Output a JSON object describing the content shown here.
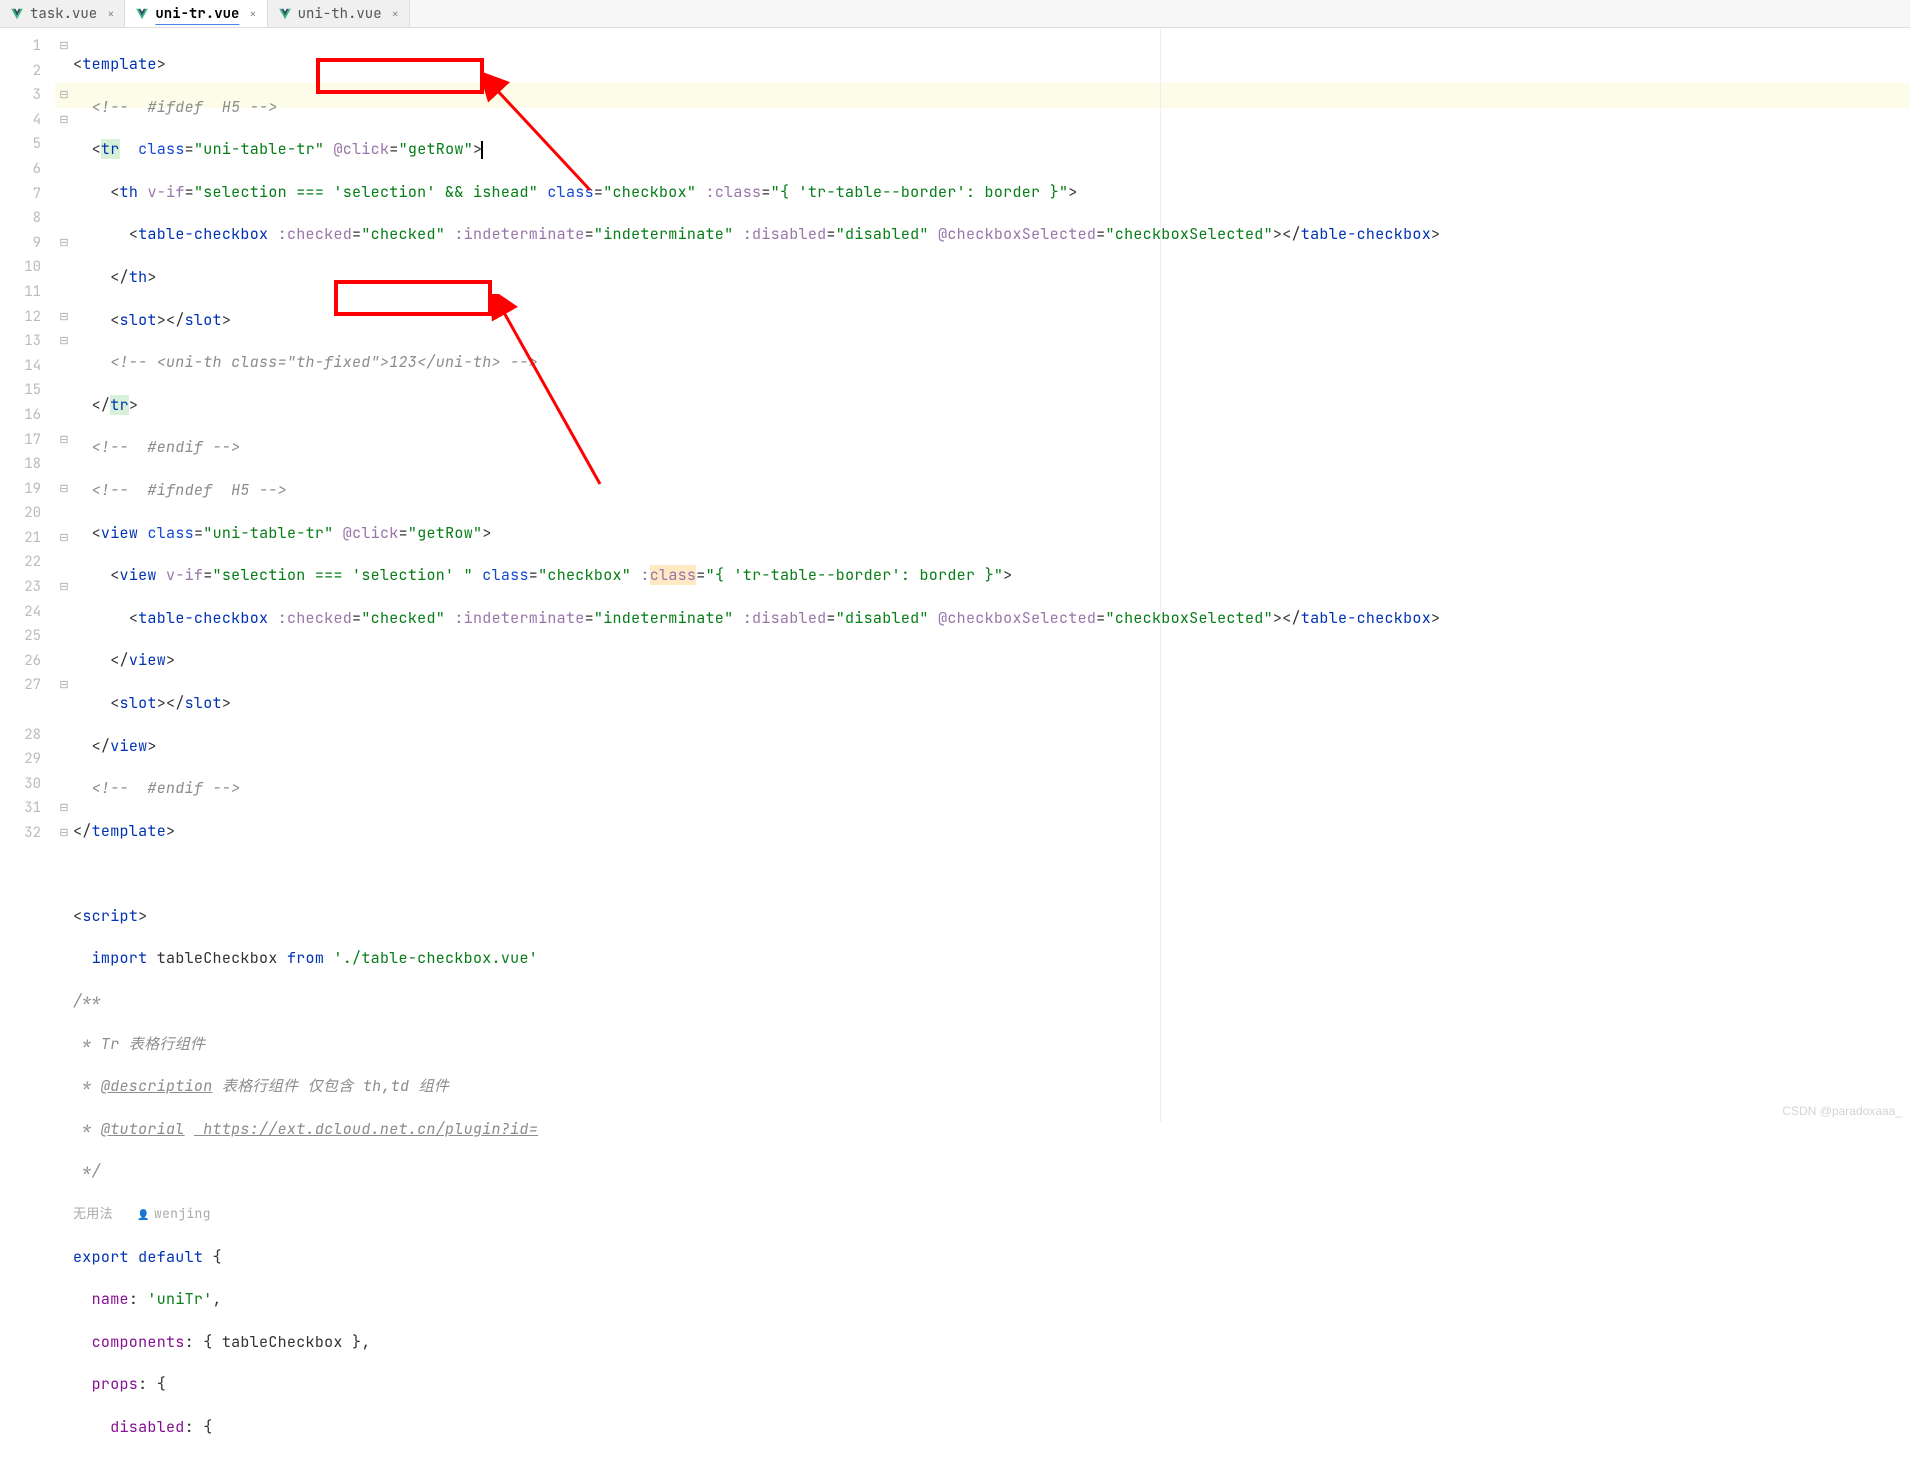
{
  "tabs": [
    {
      "name": "task.vue",
      "active": false
    },
    {
      "name": "uni-tr.vue",
      "active": true
    },
    {
      "name": "uni-th.vue",
      "active": false
    }
  ],
  "hint": {
    "usage": "无用法",
    "author": "wenjing"
  },
  "watermark": "CSDN @paradoxaaa_",
  "code": {
    "l1": {
      "lt": "<",
      "tag": "template",
      "gt": ">"
    },
    "l2": {
      "comment": "<!--  #ifdef  H5 -->"
    },
    "l3": {
      "lt": "<",
      "tag": "tr",
      "sp": "  ",
      "a1": "class",
      "eq": "=",
      "v1": "\"uni-table-tr\"",
      "sp2": " ",
      "a2": "@click",
      "v2": "\"getRow\"",
      "gt": ">"
    },
    "l4": {
      "lt": "<",
      "tag": "th",
      "sp": " ",
      "a1": "v-if",
      "v1": "\"selection === 'selection' && ishead\"",
      "a2": "class",
      "v2": "\"checkbox\"",
      "a3": ":class",
      "v3": "\"{ 'tr-table--border': border }\"",
      "gt": ">"
    },
    "l5": {
      "lt": "<",
      "tag": "table-checkbox",
      "a1": ":checked",
      "v1": "\"checked\"",
      "a2": ":indeterminate",
      "v2": "\"indeterminate\"",
      "a3": ":disabled",
      "v3": "\"disabled\"",
      "a4": "@checkboxSelected",
      "v4": "\"checkboxSelected\"",
      "gt": "></",
      "tag2": "table-checkbox",
      "gt2": ">"
    },
    "l6": {
      "cl": "</",
      "tag": "th",
      "gt": ">"
    },
    "l7": {
      "lt": "<",
      "tag": "slot",
      "mid": "></",
      "tag2": "slot",
      "gt": ">"
    },
    "l8": {
      "comment": "<!-- <uni-th class=\"th-fixed\">123</uni-th> -->"
    },
    "l9": {
      "cl": "</",
      "tag": "tr",
      "gt": ">"
    },
    "l10": {
      "comment": "<!--  #endif -->"
    },
    "l11": {
      "comment": "<!--  #ifndef  H5 -->"
    },
    "l12": {
      "lt": "<",
      "tag": "view",
      "a1": "class",
      "v1": "\"uni-table-tr\"",
      "a2": "@click",
      "v2": "\"getRow\"",
      "gt": ">"
    },
    "l13": {
      "lt": "<",
      "tag": "view",
      "a1": "v-if",
      "v1": "\"selection === 'selection' \"",
      "a2": "class",
      "v2": "\"checkbox\"",
      "a3": ":class",
      "v3": "\"{ 'tr-table--border': border }\"",
      "gt": ">"
    },
    "l14": {
      "lt": "<",
      "tag": "table-checkbox",
      "a1": ":checked",
      "v1": "\"checked\"",
      "a2": ":indeterminate",
      "v2": "\"indeterminate\"",
      "a3": ":disabled",
      "v3": "\"disabled\"",
      "a4": "@checkboxSelected",
      "v4": "\"checkboxSelected\"",
      "gt": "></",
      "tag2": "table-checkbox",
      "gt2": ">"
    },
    "l15": {
      "cl": "</",
      "tag": "view",
      "gt": ">"
    },
    "l16": {
      "lt": "<",
      "tag": "slot",
      "mid": "></",
      "tag2": "slot",
      "gt": ">"
    },
    "l17": {
      "cl": "</",
      "tag": "view",
      "gt": ">"
    },
    "l18": {
      "comment": "<!--  #endif -->"
    },
    "l19": {
      "cl": "</",
      "tag": "template",
      "gt": ">"
    },
    "l21": {
      "lt": "<",
      "tag": "script",
      "gt": ">"
    },
    "l22": {
      "kw": "import",
      "id": " tableCheckbox ",
      "kw2": "from",
      "str": " './table-checkbox.vue'"
    },
    "l23": {
      "comment": "/**"
    },
    "l24": {
      "comment": " * Tr 表格行组件"
    },
    "l25": {
      "pre": " * ",
      "kw": "@description",
      "rest": " 表格行组件 仅包含 th,td 组件"
    },
    "l26": {
      "pre": " * ",
      "kw": "@tutorial",
      "url": " https://ext.dcloud.net.cn/plugin?id="
    },
    "l27": {
      "comment": " */"
    },
    "l28": {
      "kw": "export default",
      "p": " {",
      "sp": ""
    },
    "l29": {
      "key": "name",
      "colon": ": ",
      "str": "'uniTr'",
      "comma": ","
    },
    "l30": {
      "key": "components",
      "colon": ": { ",
      "id": "tableCheckbox",
      "rest": " },"
    },
    "l31": {
      "key": "props",
      "colon": ": {"
    },
    "l32": {
      "key": "disabled",
      "colon": ": {"
    }
  },
  "line_numbers": [
    "1",
    "2",
    "3",
    "4",
    "5",
    "6",
    "7",
    "8",
    "9",
    "10",
    "11",
    "12",
    "13",
    "14",
    "15",
    "16",
    "17",
    "18",
    "19",
    "20",
    "21",
    "22",
    "23",
    "24",
    "25",
    "26",
    "27",
    "",
    "28",
    "29",
    "30",
    "31",
    "32"
  ],
  "fold_markers": [
    "⊟",
    "",
    "⊟",
    "⊟",
    "",
    "",
    "",
    "",
    "⊟",
    "",
    "",
    "⊟",
    "⊟",
    "",
    "",
    "",
    "⊟",
    "",
    "⊟",
    "",
    "⊟",
    "",
    "⊟",
    "",
    "",
    "",
    "⊟",
    "",
    "",
    "",
    "",
    "⊟",
    "⊟"
  ]
}
